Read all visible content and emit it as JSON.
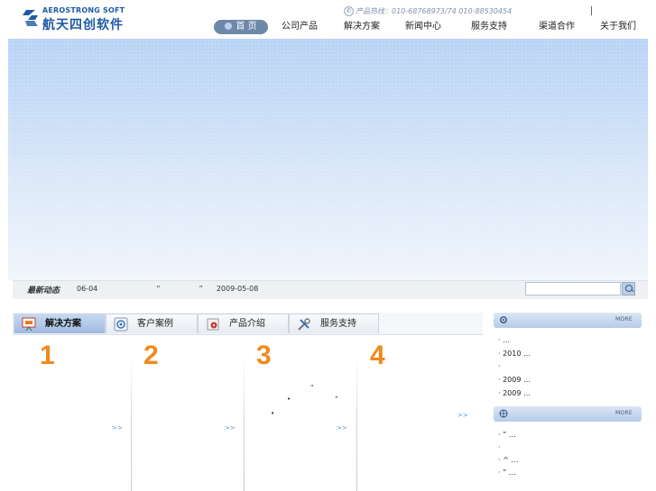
{
  "brand": {
    "name_en": "AEROSTRONG SOFT",
    "name_cn": "航天四创软件"
  },
  "hotline": {
    "text": "产品热线：010-68768973/74  010-88530454"
  },
  "nav": {
    "items": [
      "首 页",
      "公司产品",
      "解决方案",
      "新闻中心",
      "服务支持",
      "渠道合作",
      "关于我们"
    ]
  },
  "news": {
    "label": "最新动态",
    "item1_date": "06-04",
    "quote_open": "“",
    "quote_close": "”",
    "item2_date": "2009-05-08"
  },
  "search": {
    "value": ""
  },
  "tabs": [
    {
      "label": "解决方案",
      "icon": "presentation-icon"
    },
    {
      "label": "客户案例",
      "icon": "target-icon"
    },
    {
      "label": "产品介绍",
      "icon": "product-box-icon"
    },
    {
      "label": "服务支持",
      "icon": "tools-icon"
    }
  ],
  "solutions": {
    "col1": {
      "num": "1",
      "more": ">>"
    },
    "col2": {
      "num": "2",
      "more": ">>"
    },
    "col3": {
      "num": "3",
      "more": ">>",
      "mark1": "“",
      "mark2": "•",
      "mark3": "”",
      "mark4": "•"
    },
    "col4": {
      "num": "4",
      "more": ">>"
    }
  },
  "side": {
    "box1": {
      "more": "MORE",
      "lines": [
        "·     …",
        "· 2010      …",
        "·",
        "·   2009    …",
        "·      2009   …"
      ]
    },
    "box2": {
      "more": "MORE",
      "lines": [
        "·     ”       …",
        "·",
        "·     ^      …",
        "·  ”          …"
      ]
    }
  },
  "colors": {
    "accent_blue": "#1d5aa6",
    "number_orange": "#f08a1d",
    "more_link": "#5b8fd1"
  }
}
